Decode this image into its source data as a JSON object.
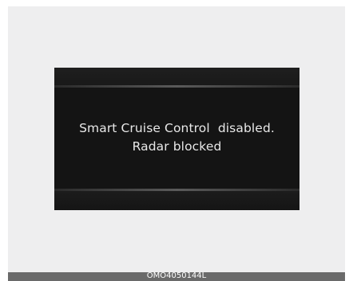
{
  "display": {
    "message_line1": "Smart Cruise Control  disabled.",
    "message_line2": "Radar blocked"
  },
  "caption": {
    "code": "OMO4050144L"
  },
  "colors": {
    "background": "#eeeeef",
    "display": "#141414",
    "text": "#e8e8e8",
    "caption_bar": "#6a6a6a"
  }
}
